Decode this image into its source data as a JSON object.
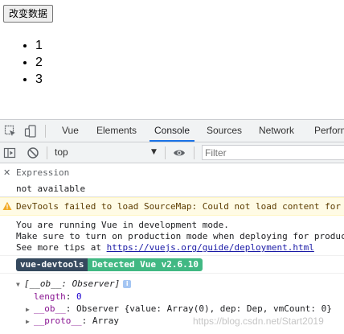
{
  "page": {
    "button_label": "改变数据",
    "list_items": [
      "1",
      "2",
      "3"
    ]
  },
  "devtools": {
    "tabs": [
      {
        "label": "Vue",
        "active": false
      },
      {
        "label": "Elements",
        "active": false
      },
      {
        "label": "Console",
        "active": true
      },
      {
        "label": "Sources",
        "active": false
      },
      {
        "label": "Network",
        "active": false
      },
      {
        "label": "Perform",
        "active": false
      }
    ],
    "accent_color": "#1a73e8"
  },
  "console_toolbar": {
    "context": "top",
    "filter_placeholder": "Filter"
  },
  "console": {
    "expression_label": "Expression",
    "expression_value": "not available",
    "warning_text": "DevTools failed to load SourceMap: Could not load content for",
    "log_lines": [
      "You are running Vue in development mode.",
      "Make sure to turn on production mode when deploying for producti",
      "See more tips at "
    ],
    "log_link": "https://vuejs.org/guide/deployment.html",
    "badge_left": "vue-devtools",
    "badge_right": "Detected Vue v2.6.10",
    "object": {
      "header": "[__ob__: Observer]",
      "length_key": "length",
      "length_value": "0",
      "ob_key": "__ob__",
      "ob_value": "Observer {value: Array(0), dep: Dep, vmCount: 0}",
      "proto_key": "__proto__",
      "proto_value": "Array"
    }
  },
  "watermark": "https://blog.csdn.net/Start2019"
}
